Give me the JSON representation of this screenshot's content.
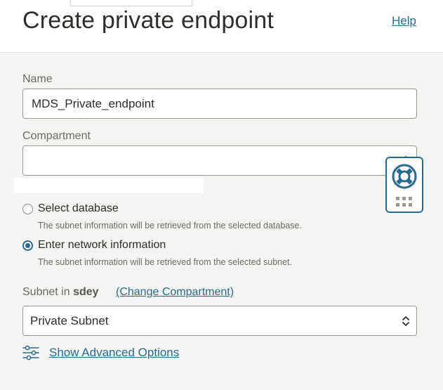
{
  "header": {
    "title": "Create private endpoint",
    "help_label": "Help"
  },
  "form": {
    "name": {
      "label": "Name",
      "value": "MDS_Private_endpoint"
    },
    "compartment": {
      "label": "Compartment",
      "value": ""
    },
    "source_options": [
      {
        "label": "Select database",
        "helper": "The subnet information will be retrieved from the selected database.",
        "selected": false
      },
      {
        "label": "Enter network information",
        "helper": "The subnet information will be retrieved from the selected subnet.",
        "selected": true
      }
    ],
    "subnet": {
      "label_prefix": "Subnet in",
      "compartment_name": "sdey",
      "change_compartment_label": "(Change Compartment)",
      "value": "Private Subnet"
    },
    "advanced_options_label": "Show Advanced Options"
  },
  "colors": {
    "accent": "#2b6a8f",
    "page_background": "#f4f4f3",
    "text": "#312d2a",
    "muted_text": "#6f6a66"
  },
  "icons": {
    "help_widget": "lifebuoy-icon",
    "widget_handle": "drag-grip-icon",
    "advanced_options": "sliders-icon",
    "select_chevrons": "chevron-up-down-icon"
  }
}
